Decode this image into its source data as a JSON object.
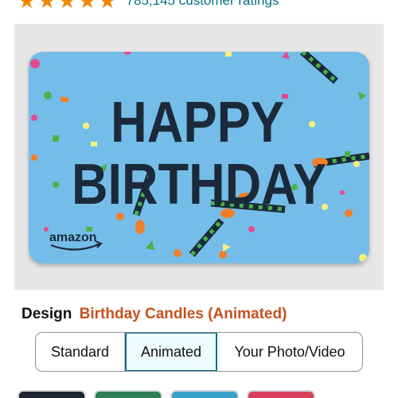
{
  "ratings": {
    "star_count": 5,
    "filled_stars": 5,
    "count_text": "785,145 customer ratings"
  },
  "card": {
    "line1": "HAPPY",
    "line2": "BIRTHDAY",
    "brand": "amazon",
    "background_color": "#75bde9",
    "text_color": "#1b2a3a"
  },
  "design": {
    "label": "Design",
    "value": "Birthday Candles (Animated)"
  },
  "options": {
    "items": [
      "Standard",
      "Animated",
      "Your Photo/Video"
    ],
    "selected": "Animated"
  },
  "colors": {
    "accent_orange": "#c7511f",
    "star_orange": "#f08804",
    "link_teal": "#007185",
    "selected_border": "#007185"
  }
}
